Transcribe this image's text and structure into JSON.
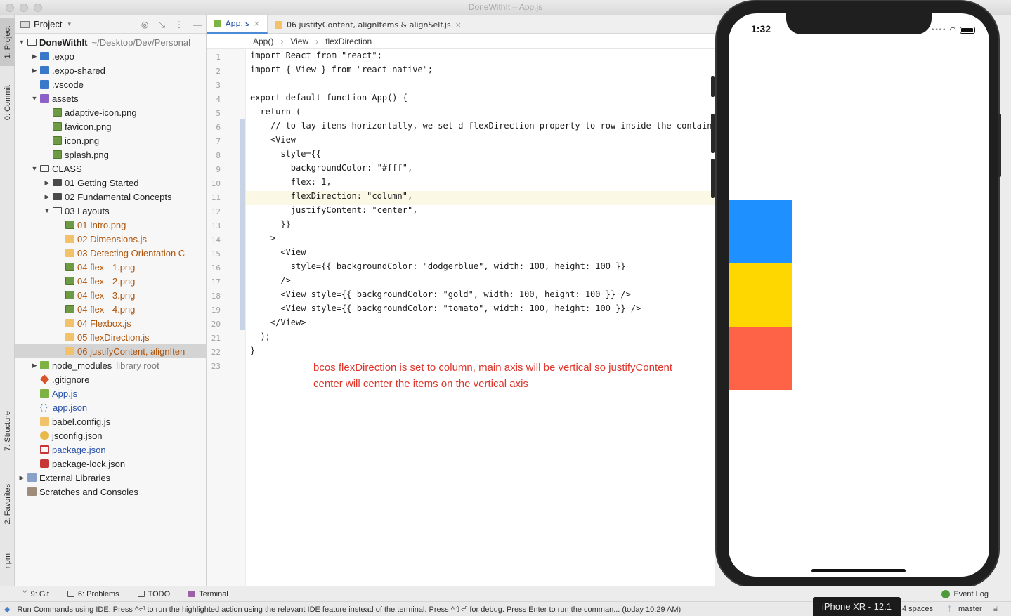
{
  "window": {
    "title": "DoneWithIt – App.js"
  },
  "left_strip": {
    "tabs": [
      {
        "label": "1: Project"
      },
      {
        "label": "0: Commit"
      },
      {
        "label": "7: Structure"
      },
      {
        "label": "2: Favorites"
      },
      {
        "label": "npm"
      }
    ]
  },
  "project_panel": {
    "title": "Project",
    "tree": [
      {
        "label": "DoneWithIt",
        "extra": "~/Desktop/Dev/Personal",
        "depth": 0,
        "arrow": "down",
        "icon": "folder-open-icon"
      },
      {
        "label": ".expo",
        "depth": 1,
        "arrow": "right",
        "icon": "folder-blue-icon"
      },
      {
        "label": ".expo-shared",
        "depth": 1,
        "arrow": "right",
        "icon": "folder-blue-icon"
      },
      {
        "label": ".vscode",
        "depth": 1,
        "arrow": "",
        "icon": "folder-blue-icon"
      },
      {
        "label": "assets",
        "depth": 1,
        "arrow": "down",
        "icon": "folder-purple-icon"
      },
      {
        "label": "adaptive-icon.png",
        "depth": 2,
        "arrow": "",
        "icon": "image-icon"
      },
      {
        "label": "favicon.png",
        "depth": 2,
        "arrow": "",
        "icon": "image-icon"
      },
      {
        "label": "icon.png",
        "depth": 2,
        "arrow": "",
        "icon": "image-icon"
      },
      {
        "label": "splash.png",
        "depth": 2,
        "arrow": "",
        "icon": "image-icon"
      },
      {
        "label": "CLASS",
        "depth": 1,
        "arrow": "down",
        "icon": "folder-open-icon"
      },
      {
        "label": "01 Getting Started",
        "depth": 2,
        "arrow": "right",
        "icon": "folder-icon"
      },
      {
        "label": "02 Fundamental Concepts",
        "depth": 2,
        "arrow": "right",
        "icon": "folder-icon"
      },
      {
        "label": "03 Layouts",
        "depth": 2,
        "arrow": "down",
        "icon": "folder-open-icon"
      },
      {
        "label": "01 Intro.png",
        "depth": 3,
        "arrow": "",
        "icon": "image-icon",
        "color": "orange"
      },
      {
        "label": "02 Dimensions.js",
        "depth": 3,
        "arrow": "",
        "icon": "js-file-icon",
        "color": "orange"
      },
      {
        "label": "03 Detecting Orientation C",
        "depth": 3,
        "arrow": "",
        "icon": "js-file-icon",
        "color": "orange"
      },
      {
        "label": "04 flex - 1.png",
        "depth": 3,
        "arrow": "",
        "icon": "image-icon",
        "color": "orange"
      },
      {
        "label": "04 flex - 2.png",
        "depth": 3,
        "arrow": "",
        "icon": "image-icon",
        "color": "orange"
      },
      {
        "label": "04 flex - 3.png",
        "depth": 3,
        "arrow": "",
        "icon": "image-icon",
        "color": "orange"
      },
      {
        "label": "04 flex - 4.png",
        "depth": 3,
        "arrow": "",
        "icon": "image-icon",
        "color": "orange"
      },
      {
        "label": "04 Flexbox.js",
        "depth": 3,
        "arrow": "",
        "icon": "js-file-icon",
        "color": "orange"
      },
      {
        "label": "05 flexDirection.js",
        "depth": 3,
        "arrow": "",
        "icon": "js-file-icon",
        "color": "orange"
      },
      {
        "label": "06 justifyContent, alignIten",
        "depth": 3,
        "arrow": "",
        "icon": "js-file-icon",
        "color": "orange",
        "selected": true
      },
      {
        "label": "node_modules",
        "extra": "library root",
        "depth": 1,
        "arrow": "right",
        "icon": "folder-green-icon"
      },
      {
        "label": ".gitignore",
        "depth": 1,
        "arrow": "",
        "icon": "git-icon"
      },
      {
        "label": "App.js",
        "depth": 1,
        "arrow": "",
        "icon": "js-react-icon",
        "color": "blue"
      },
      {
        "label": "app.json",
        "depth": 1,
        "arrow": "",
        "icon": "json-icon",
        "color": "blue"
      },
      {
        "label": "babel.config.js",
        "depth": 1,
        "arrow": "",
        "icon": "js-file-icon"
      },
      {
        "label": "jsconfig.json",
        "depth": 1,
        "arrow": "",
        "icon": "config-icon"
      },
      {
        "label": "package.json",
        "depth": 1,
        "arrow": "",
        "icon": "npm-icon",
        "color": "blue"
      },
      {
        "label": "package-lock.json",
        "depth": 1,
        "arrow": "",
        "icon": "lock-icon"
      },
      {
        "label": "External Libraries",
        "depth": 0,
        "arrow": "right",
        "icon": "library-icon"
      },
      {
        "label": "Scratches and Consoles",
        "depth": 0,
        "arrow": "",
        "icon": "scratch-icon"
      }
    ]
  },
  "editor": {
    "tabs": [
      {
        "label": "App.js",
        "active": true
      },
      {
        "label": "06 justifyContent, alignItems & alignSelf.js",
        "active": false
      }
    ],
    "breadcrumb": [
      "App()",
      "View",
      "flexDirection"
    ],
    "lines": [
      "import React from \"react\";",
      "import { View } from \"react-native\";",
      "",
      "export default function App() {",
      "  return (",
      "    // to lay items horizontally, we set d flexDirection property to row inside the container",
      "    <View",
      "      style={{",
      "        backgroundColor: \"#fff\",",
      "        flex: 1,",
      "        flexDirection: \"column\",",
      "        justifyContent: \"center\",",
      "      }}",
      "    >",
      "      <View",
      "        style={{ backgroundColor: \"dodgerblue\", width: 100, height: 100 }}",
      "      />",
      "      <View style={{ backgroundColor: \"gold\", width: 100, height: 100 }} />",
      "      <View style={{ backgroundColor: \"tomato\", width: 100, height: 100 }} />",
      "    </View>",
      "  );",
      "}",
      ""
    ],
    "current_line": 11,
    "note_line1": "bcos flexDirection is set to column, main axis will be vertical so justifyContent",
    "note_line2": "center will center the items on the vertical axis"
  },
  "simulator": {
    "time": "1:32",
    "boxes": [
      {
        "color": "#1e90ff"
      },
      {
        "color": "#ffd700"
      },
      {
        "color": "#ff6347"
      }
    ],
    "device_label": "iPhone XR - 12.1"
  },
  "bottom_tools": [
    {
      "label": "9: Git",
      "color": "#3d7bd6"
    },
    {
      "label": "6: Problems",
      "color": "#555555"
    },
    {
      "label": "TODO",
      "color": "#555555"
    },
    {
      "label": "Terminal",
      "color": "#9c5fa8"
    }
  ],
  "event_log": "Event Log",
  "status": {
    "message": "Run Commands using IDE: Press ^⏎ to run the highlighted action using the relevant IDE feature instead of the terminal. Press ^⇧⏎ for debug. Press Enter to run the comman... (today 10:29 AM)",
    "indent": "4 spaces",
    "branch": "master"
  }
}
